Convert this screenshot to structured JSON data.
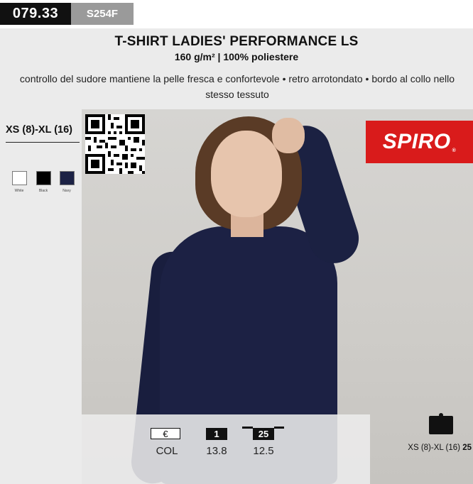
{
  "header": {
    "code_main": "079.33",
    "code_secondary": "S254F"
  },
  "product": {
    "title": "T-SHIRT LADIES' PERFORMANCE  LS",
    "subtitle": "160 g/m² | 100% poliestere",
    "description": "controllo del sudore mantiene la pelle fresca e confortevole • retro arrotondato • bordo al collo nello stesso tessuto"
  },
  "sizes": {
    "range": "XS (8)-XL (16)"
  },
  "colors": [
    {
      "name": "White",
      "hex": "#ffffff"
    },
    {
      "name": "Black",
      "hex": "#000000"
    },
    {
      "name": "Navy",
      "hex": "#1c2245"
    }
  ],
  "brand": {
    "logo_text": "SPIRO",
    "logo_mark": "®",
    "logo_color": "#d91b1b"
  },
  "pricing": {
    "currency_symbol": "€",
    "col_label": "COL",
    "tiers": [
      {
        "qty": "1",
        "price": "13.8"
      },
      {
        "qty": "25",
        "price": "12.5"
      }
    ]
  },
  "packaging": {
    "icon": "box-icon",
    "size_range": "XS (8)-XL (16)",
    "quantity": "25"
  },
  "qr_icon": "qr-code-icon",
  "photo": "woman-wearing-navy-long-sleeve-tshirt"
}
